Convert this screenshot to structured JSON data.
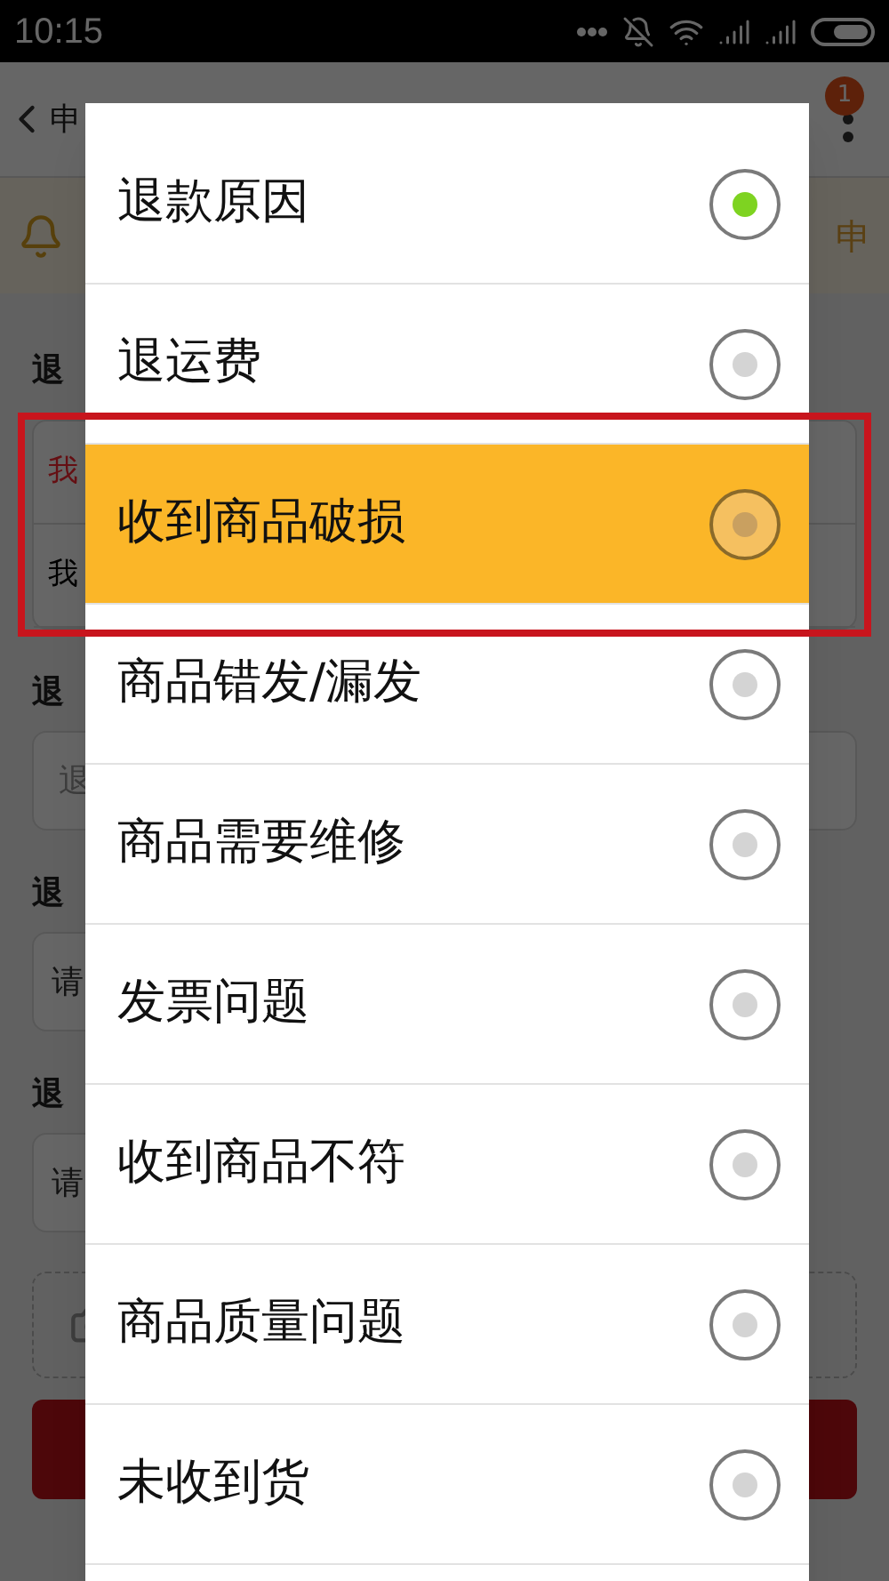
{
  "status_bar": {
    "time": "10:15"
  },
  "background": {
    "header_title": "申",
    "badge": "1",
    "notice_text": "申",
    "sections": [
      {
        "label": "退",
        "kind": "group",
        "rows": [
          {
            "text": "我",
            "highlight": true
          },
          {
            "text": "我",
            "highlight": false
          }
        ]
      },
      {
        "label": "退",
        "kind": "select",
        "value": "退"
      },
      {
        "label": "退",
        "kind": "input",
        "placeholder": "请"
      },
      {
        "label": "退",
        "kind": "input",
        "placeholder": "请"
      }
    ]
  },
  "dialog": {
    "options": [
      {
        "label": "退款原因",
        "selected": true,
        "pressed": false
      },
      {
        "label": "退运费",
        "selected": false,
        "pressed": false
      },
      {
        "label": "收到商品破损",
        "selected": false,
        "pressed": true
      },
      {
        "label": "商品错发/漏发",
        "selected": false,
        "pressed": false
      },
      {
        "label": "商品需要维修",
        "selected": false,
        "pressed": false
      },
      {
        "label": "发票问题",
        "selected": false,
        "pressed": false
      },
      {
        "label": "收到商品不符",
        "selected": false,
        "pressed": false
      },
      {
        "label": "商品质量问题",
        "selected": false,
        "pressed": false
      },
      {
        "label": "未收到货",
        "selected": false,
        "pressed": false
      }
    ]
  }
}
